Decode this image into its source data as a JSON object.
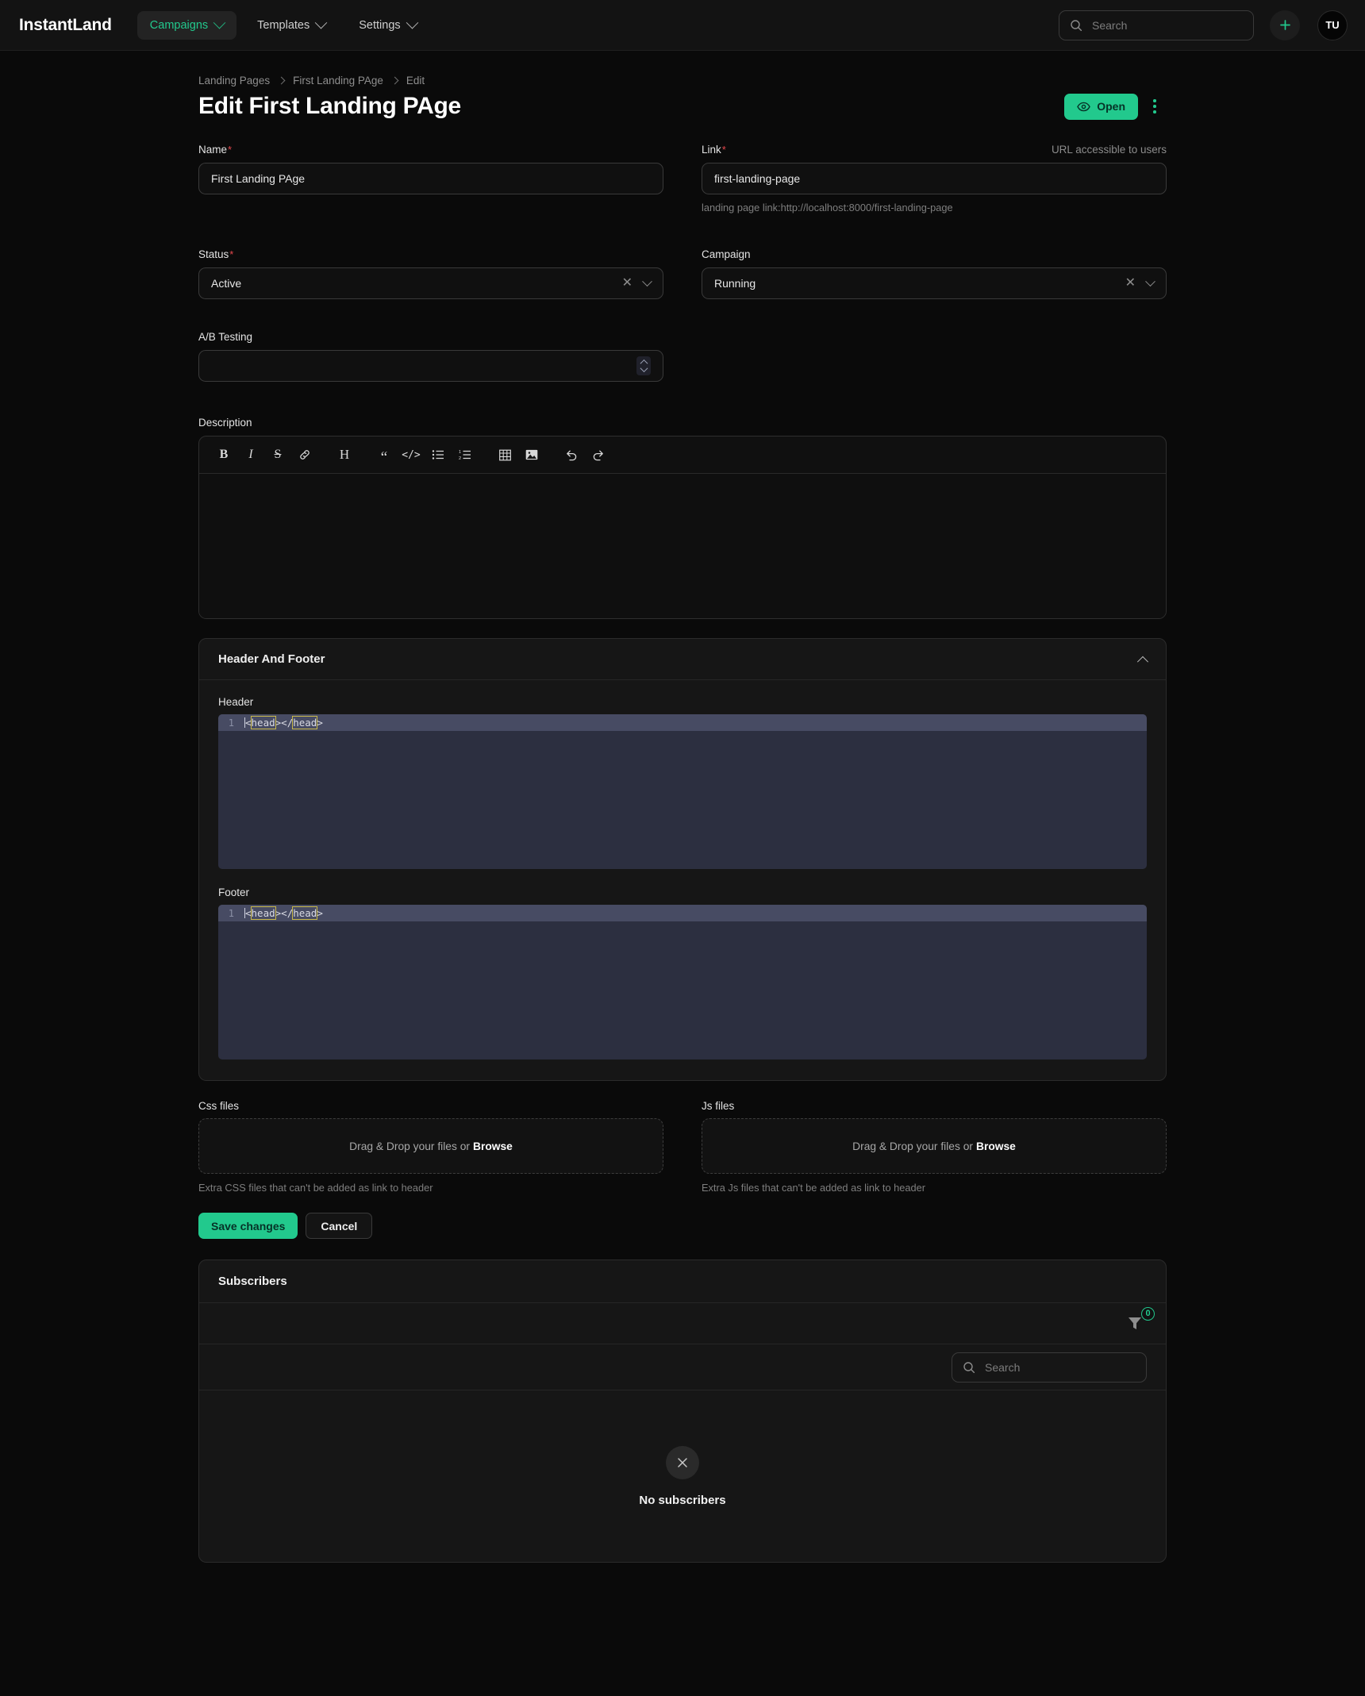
{
  "app": {
    "brand": "InstantLand",
    "accent_color": "#22c98d",
    "nav": [
      {
        "label": "Campaigns",
        "active": true
      },
      {
        "label": "Templates",
        "active": false
      },
      {
        "label": "Settings",
        "active": false
      }
    ],
    "search_placeholder": "Search",
    "search_value": "",
    "add_button_label": "+",
    "avatar_initials": "TU"
  },
  "breadcrumb": [
    "Landing Pages",
    "First Landing PAge",
    "Edit"
  ],
  "header": {
    "title": "Edit First Landing PAge",
    "open_label": "Open"
  },
  "form": {
    "name": {
      "label": "Name",
      "required": "*",
      "value": "First Landing PAge",
      "placeholder": ""
    },
    "link": {
      "label": "Link",
      "required": "*",
      "hint": "URL accessible to users",
      "value": "first-landing-page",
      "placeholder": "",
      "helper": "landing page link:http://localhost:8000/first-landing-page"
    },
    "status": {
      "label": "Status",
      "required": "*",
      "value": "Active"
    },
    "campaign": {
      "label": "Campaign",
      "required": "",
      "value": "Running"
    },
    "ab_testing": {
      "label": "A/B Testing",
      "value": "",
      "placeholder": ""
    },
    "description": {
      "label": "Description",
      "value": "",
      "toolbar": [
        {
          "name": "bold-icon",
          "glyph": "B"
        },
        {
          "name": "italic-icon",
          "glyph": "I"
        },
        {
          "name": "strikethrough-icon",
          "glyph": "S"
        },
        {
          "name": "link-icon",
          "glyph": "⎇"
        },
        {
          "name": "heading-icon",
          "glyph": "H"
        },
        {
          "name": "blockquote-icon",
          "glyph": "“"
        },
        {
          "name": "code-icon",
          "glyph": "</>"
        },
        {
          "name": "bullet-list-icon",
          "glyph": "☰"
        },
        {
          "name": "ordered-list-icon",
          "glyph": "1."
        },
        {
          "name": "table-icon",
          "glyph": "▦"
        },
        {
          "name": "image-icon",
          "glyph": "ὛC"
        },
        {
          "name": "undo-icon",
          "glyph": "↶"
        },
        {
          "name": "redo-icon",
          "glyph": "↷"
        }
      ]
    }
  },
  "header_footer_panel": {
    "title": "Header And Footer",
    "collapsed": false,
    "header_field": {
      "label": "Header",
      "line_number": "1",
      "code": "<head></head>"
    },
    "footer_field": {
      "label": "Footer",
      "line_number": "1",
      "code": "<head></head>"
    }
  },
  "files": {
    "css": {
      "label": "Css files",
      "dropzone_text": "Drag & Drop your files or",
      "browse_label": "Browse",
      "helper": "Extra CSS files that can't be added as link to header"
    },
    "js": {
      "label": "Js files",
      "dropzone_text": "Drag & Drop your files or",
      "browse_label": "Browse",
      "helper": "Extra Js files that can't be added as link to header"
    }
  },
  "actions": {
    "save_label": "Save changes",
    "cancel_label": "Cancel"
  },
  "subscribers": {
    "title": "Subscribers",
    "filter_count": "0",
    "search_placeholder": "Search",
    "search_value": "",
    "empty_text": "No subscribers"
  }
}
